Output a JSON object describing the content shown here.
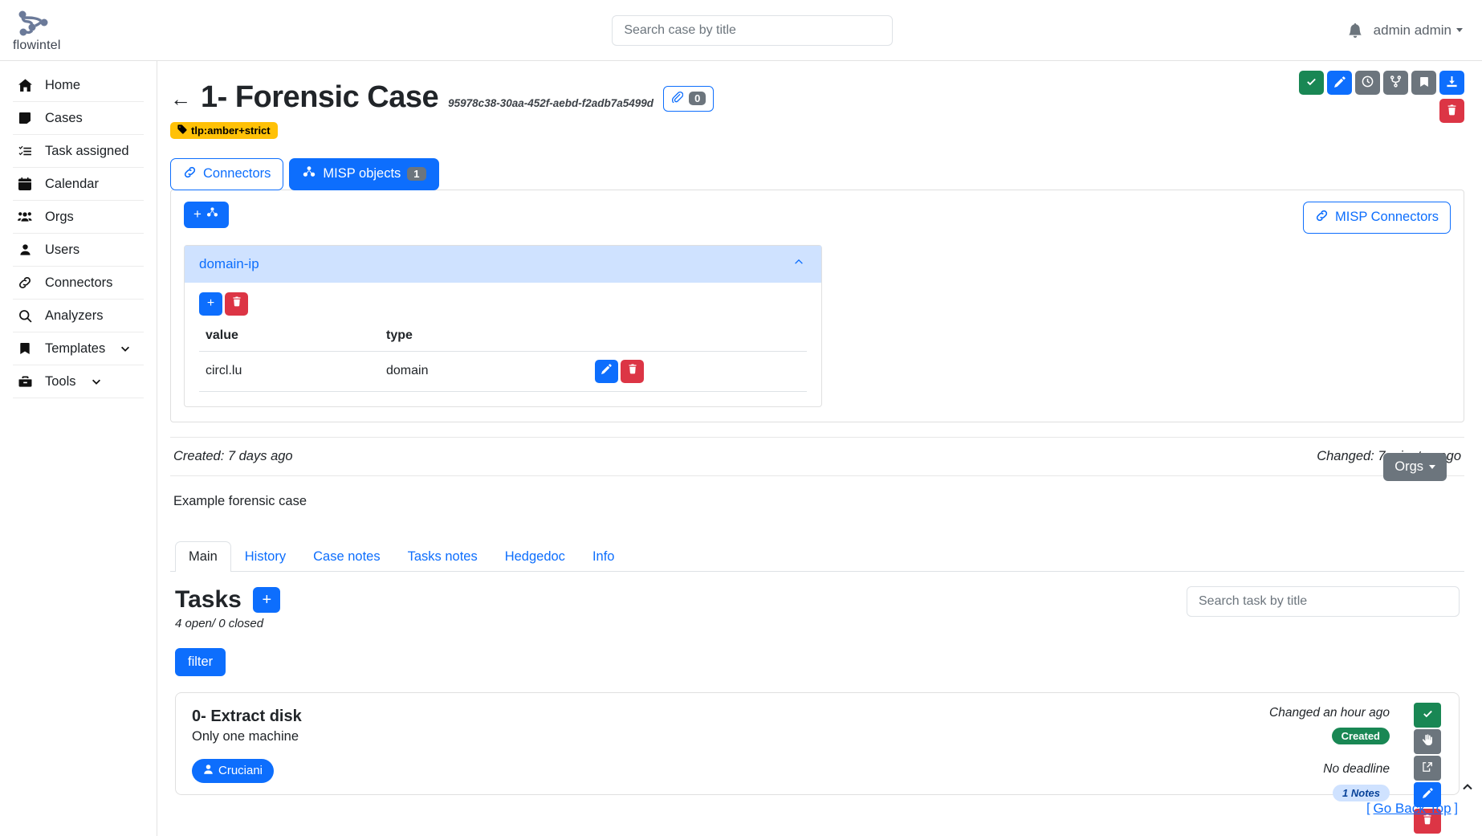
{
  "brand": {
    "name": "flowintel",
    "logo_icon": "node-graph-icon"
  },
  "navbar": {
    "search_placeholder": "Search case by title",
    "search_value": "",
    "notification_icon": "bell-icon",
    "user_label": "admin admin",
    "user_caret_icon": "caret-down-icon"
  },
  "sidebar": {
    "items": [
      {
        "label": "Home",
        "icon": "home-icon",
        "expandable": false
      },
      {
        "label": "Cases",
        "icon": "case-note-icon",
        "expandable": false
      },
      {
        "label": "Task assigned",
        "icon": "task-list-icon",
        "expandable": false
      },
      {
        "label": "Calendar",
        "icon": "calendar-icon",
        "expandable": false
      },
      {
        "label": "Orgs",
        "icon": "users-group-icon",
        "expandable": false
      },
      {
        "label": "Users",
        "icon": "user-icon",
        "expandable": false
      },
      {
        "label": "Connectors",
        "icon": "link-icon",
        "expandable": false
      },
      {
        "label": "Analyzers",
        "icon": "search-icon",
        "expandable": false
      },
      {
        "label": "Templates",
        "icon": "bookmark-icon",
        "expandable": true
      },
      {
        "label": "Tools",
        "icon": "toolbox-icon",
        "expandable": true
      }
    ]
  },
  "case": {
    "back_icon": "arrow-left-icon",
    "title": "1- Forensic Case",
    "uuid": "95978c38-30aa-452f-aebd-f2adb7a5499d",
    "attachment_icon": "paperclip-icon",
    "attachment_count": "0",
    "tlp_tag": "tlp:amber+strict",
    "tlp_tag_icon": "tag-icon",
    "tlp_color": "#ffc107",
    "created": "Created: 7 days ago",
    "changed": "Changed: 7 minutes ago",
    "description": "Example forensic case",
    "orgs_button": "Orgs",
    "orgs_caret_icon": "caret-down-icon"
  },
  "case_actions": [
    {
      "name": "complete-case-button",
      "icon": "check-icon",
      "color": "#198754"
    },
    {
      "name": "edit-case-button",
      "icon": "pencil-square-icon",
      "color": "#0d6efd"
    },
    {
      "name": "history-case-button",
      "icon": "clock-icon",
      "color": "#6c757d"
    },
    {
      "name": "recurring-case-button",
      "icon": "fork-icon",
      "color": "#6c757d"
    },
    {
      "name": "bookmark-case-button",
      "icon": "bookmark-icon",
      "color": "#6c757d"
    },
    {
      "name": "export-case-button",
      "icon": "download-icon",
      "color": "#0d6efd"
    },
    {
      "name": "delete-case-button",
      "icon": "trash-icon",
      "color": "#dc3545"
    }
  ],
  "connector_tabs": [
    {
      "label": "Connectors",
      "icon": "link-icon",
      "active": false,
      "badge": ""
    },
    {
      "label": "MISP objects",
      "icon": "misp-cubes-icon",
      "active": true,
      "badge": "1"
    }
  ],
  "misp_panel": {
    "add_button_icon": "plus-misp-icon",
    "misp_connectors_button": "MISP Connectors",
    "misp_connectors_icon": "link-icon",
    "object": {
      "name": "domain-ip",
      "collapse_icon": "chevron-up-icon",
      "add_attribute_icon": "plus-icon",
      "delete_object_icon": "trash-icon",
      "columns": [
        "value",
        "type"
      ],
      "rows": [
        {
          "value": "circl.lu",
          "type": "domain",
          "edit_icon": "pencil-square-icon",
          "delete_icon": "trash-icon"
        }
      ]
    }
  },
  "main_tabs": [
    {
      "label": "Main",
      "active": true
    },
    {
      "label": "History",
      "active": false
    },
    {
      "label": "Case notes",
      "active": false
    },
    {
      "label": "Tasks notes",
      "active": false
    },
    {
      "label": "Hedgedoc",
      "active": false
    },
    {
      "label": "Info",
      "active": false
    }
  ],
  "tasks_section": {
    "heading": "Tasks",
    "add_icon": "plus-icon",
    "counts": "4 open/ 0 closed",
    "filter_button": "filter",
    "search_placeholder": "Search task by title",
    "search_value": ""
  },
  "tasks": [
    {
      "title": "0- Extract disk",
      "subtitle": "Only one machine",
      "assignee": "Cruciani",
      "assignee_icon": "user-icon",
      "changed": "Changed an hour ago",
      "status": "Created",
      "status_color": "#198754",
      "deadline": "No deadline",
      "notes": "1 Notes",
      "actions": [
        {
          "name": "complete-task-button",
          "icon": "check-icon",
          "color": "#198754"
        },
        {
          "name": "take-task-button",
          "icon": "hand-icon",
          "color": "#6c757d"
        },
        {
          "name": "export-task-button",
          "icon": "share-icon",
          "color": "#6c757d"
        },
        {
          "name": "edit-task-button",
          "icon": "pencil-icon",
          "color": "#0d6efd"
        },
        {
          "name": "delete-task-button",
          "icon": "trash-icon",
          "color": "#dc3545"
        }
      ]
    }
  ],
  "footer": {
    "go_back_top": "Go Back Top",
    "bracket_open": "[",
    "bracket_close": "]",
    "scroll_top_icon": "chevron-up-icon"
  }
}
